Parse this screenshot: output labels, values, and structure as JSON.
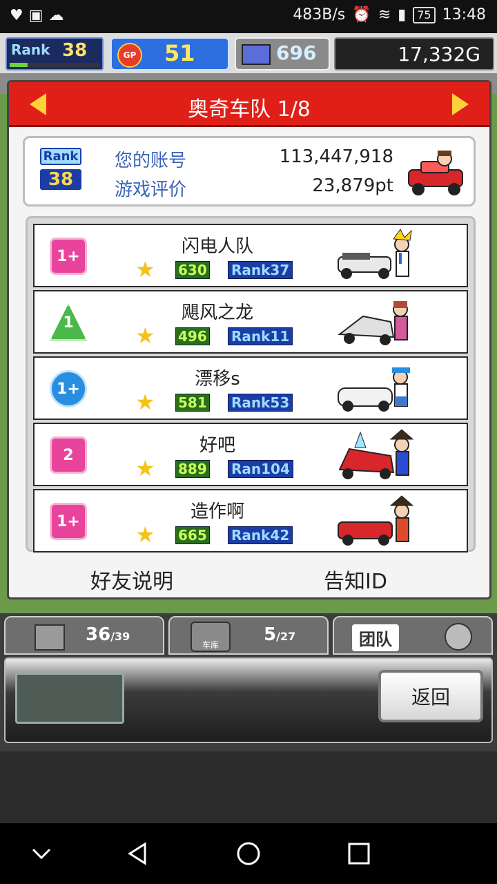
{
  "status_bar": {
    "speed": "483B/s",
    "battery": "75",
    "time": "13:48"
  },
  "hud": {
    "rank_label": "Rank",
    "rank_value": "38",
    "gp_label": "GP",
    "gp_value": "51",
    "pc_value": "696",
    "gold": "17,332G"
  },
  "dialog": {
    "title": "奥奇车队 1/8",
    "rank_label": "Rank",
    "rank_value": "38",
    "account_label": "您的账号",
    "account_value": "113,447,918",
    "rating_label": "游戏评价",
    "rating_value": "23,879pt",
    "friends": [
      {
        "name": "闪电人队",
        "level": "1+",
        "score": "630",
        "rank": "Rank37",
        "badge": "pink"
      },
      {
        "name": "飓风之龙",
        "level": "1",
        "score": "496",
        "rank": "Rank11",
        "badge": "green"
      },
      {
        "name": "漂移s",
        "level": "1+",
        "score": "581",
        "rank": "Rank53",
        "badge": "blue"
      },
      {
        "name": "好吧",
        "level": "2",
        "score": "889",
        "rank": "Ran104",
        "badge": "pink"
      },
      {
        "name": "造作啊",
        "level": "1+",
        "score": "665",
        "rank": "Rank42",
        "badge": "pink"
      }
    ],
    "footer_left": "好友说明",
    "footer_right": "告知ID"
  },
  "lower_hud": {
    "tab1_count": "36",
    "tab1_total": "/39",
    "tab2_label": "车库",
    "tab2_count": "5",
    "tab2_total": "/27",
    "tab3_label": "团队",
    "back_button": "返回"
  },
  "colors": {
    "header_red": "#e02018",
    "arrow_yellow": "#ffd23a",
    "label_blue": "#3a63b8"
  }
}
